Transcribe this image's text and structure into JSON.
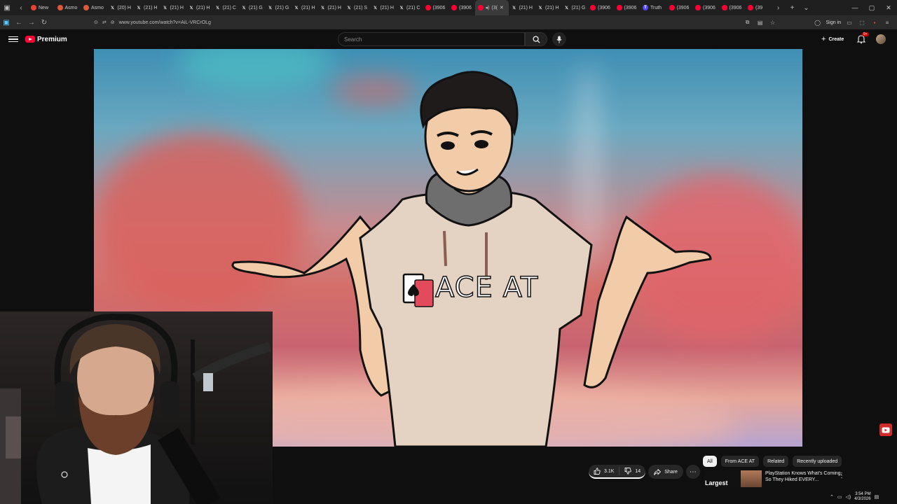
{
  "browser": {
    "tabs": [
      {
        "label": "New",
        "icon": "google-icon",
        "color": "#ea4335"
      },
      {
        "label": "Asmo",
        "icon": "brand-icon",
        "color": "#e05a3a"
      },
      {
        "label": "Asmo",
        "icon": "brand-icon",
        "color": "#e05a3a"
      },
      {
        "label": "(20) H",
        "icon": "x-icon",
        "color": "#000000"
      },
      {
        "label": "(21) H",
        "icon": "x-icon",
        "color": "#000000"
      },
      {
        "label": "(21) H",
        "icon": "x-icon",
        "color": "#000000"
      },
      {
        "label": "(21) H",
        "icon": "x-icon",
        "color": "#000000"
      },
      {
        "label": "(21) C",
        "icon": "x-icon",
        "color": "#000000"
      },
      {
        "label": "(21) G",
        "icon": "x-icon",
        "color": "#000000"
      },
      {
        "label": "(21) G",
        "icon": "x-icon",
        "color": "#000000"
      },
      {
        "label": "(21) H",
        "icon": "x-icon",
        "color": "#000000"
      },
      {
        "label": "(21) H",
        "icon": "x-icon",
        "color": "#000000"
      },
      {
        "label": "(21) S",
        "icon": "x-icon",
        "color": "#000000"
      },
      {
        "label": "(21) H",
        "icon": "x-icon",
        "color": "#000000"
      },
      {
        "label": "(21) C",
        "icon": "x-icon",
        "color": "#000000"
      },
      {
        "label": "(3906",
        "icon": "youtube-icon",
        "color": "#ff0033"
      },
      {
        "label": "(3906",
        "icon": "youtube-icon",
        "color": "#ff0033"
      },
      {
        "label": "(3(",
        "icon": "youtube-icon",
        "color": "#ff0033",
        "active": true
      },
      {
        "label": "(21) H",
        "icon": "x-icon",
        "color": "#000000"
      },
      {
        "label": "(21) H",
        "icon": "x-icon",
        "color": "#000000"
      },
      {
        "label": "(21) G",
        "icon": "x-icon",
        "color": "#000000"
      },
      {
        "label": "(3906",
        "icon": "youtube-icon",
        "color": "#ff0033"
      },
      {
        "label": "(3906",
        "icon": "youtube-icon",
        "color": "#ff0033"
      },
      {
        "label": "Truth",
        "icon": "truth-icon",
        "color": "#5448ee"
      },
      {
        "label": "(3906",
        "icon": "youtube-icon",
        "color": "#ff0033"
      },
      {
        "label": "(3906",
        "icon": "youtube-icon",
        "color": "#ff0033"
      },
      {
        "label": "(3906",
        "icon": "youtube-icon",
        "color": "#ff0033"
      },
      {
        "label": "(39",
        "icon": "youtube-icon",
        "color": "#ff0033"
      }
    ],
    "url": "www.youtube.com/watch?v=AiL-VRCrOLg",
    "sign_in": "Sign in"
  },
  "header": {
    "logo_text": "Premium",
    "search_placeholder": "Search",
    "create_label": "Create",
    "notif_badge": "9+"
  },
  "video": {
    "shirt_text": "ACE AT"
  },
  "actions": {
    "likes": "3.1K",
    "dislikes": "14",
    "share": "Share"
  },
  "chips": [
    "All",
    "From ACE AT",
    "Related",
    "Recently uploaded"
  ],
  "recommendation": {
    "thumb_word": "Largest",
    "title": "PlayStation Knows What's Coming, So They Hiked EVERY..."
  },
  "taskbar": {
    "time": "3:54 PM",
    "date": "4/3/2026"
  },
  "colors": {
    "yt_red": "#ff0033",
    "bg": "#0f0f0f"
  }
}
